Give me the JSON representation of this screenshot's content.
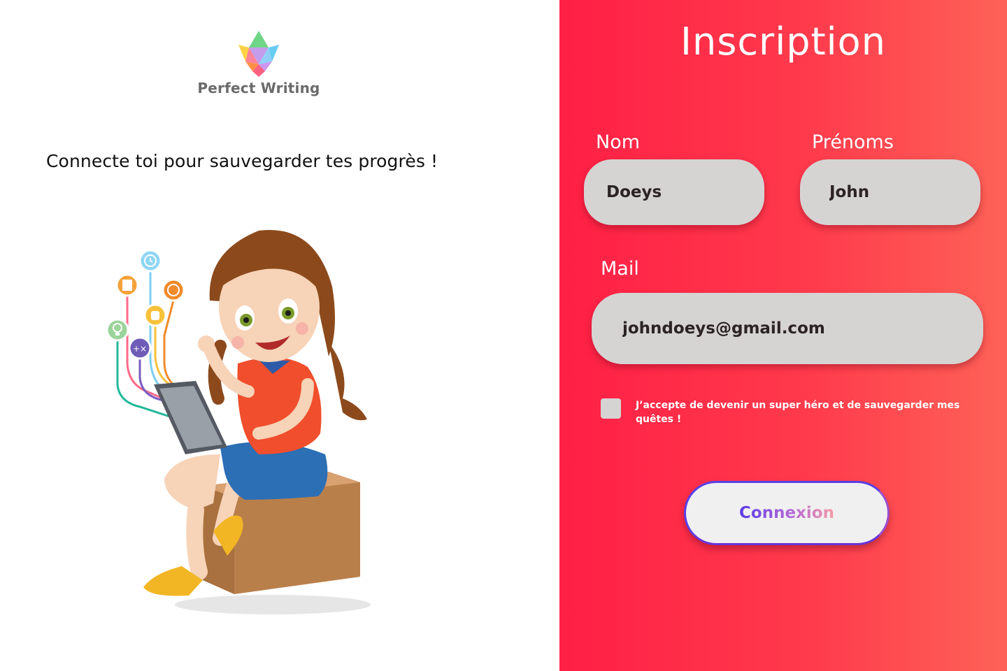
{
  "brand": {
    "name": "Perfect Writing"
  },
  "left": {
    "tagline": "Connecte toi pour sauvegarder tes progrès !"
  },
  "form": {
    "title": "Inscription",
    "nom": {
      "label": "Nom",
      "value": "Doeys"
    },
    "prenoms": {
      "label": "Prénoms",
      "value": "John"
    },
    "mail": {
      "label": "Mail",
      "value": "johndoeys@gmail.com"
    },
    "consent": {
      "checked": false,
      "text": "J’accepte de devenir un super héro et de sauvegarder mes quêtes !"
    },
    "submit_label": "Connexion"
  },
  "colors": {
    "panel_start": "#ff1f45",
    "panel_end": "#fd6257",
    "field_bg": "#d6d3d3",
    "button_accent": "#5b3ce8"
  },
  "icons": {
    "logo": "star-logo-icon",
    "app_icons": [
      "clock-icon",
      "note-icon",
      "globe-icon",
      "hand-icon",
      "lightbulb-icon",
      "math-icon"
    ]
  }
}
